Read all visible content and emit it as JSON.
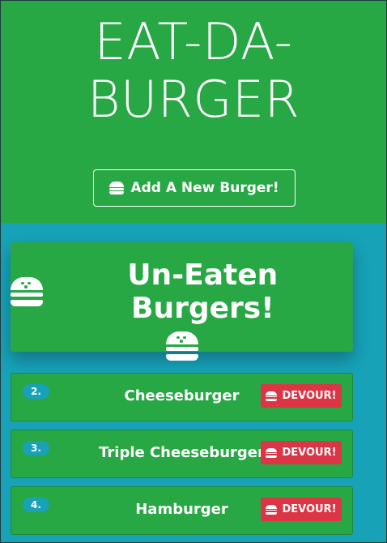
{
  "header": {
    "title_line1": "EAT-DA-",
    "title_line2": "BURGER",
    "add_button_label": "Add A New Burger!"
  },
  "section": {
    "title": "Un-Eaten Burgers!"
  },
  "burgers": [
    {
      "number": "2.",
      "name": "Cheeseburger",
      "action": "DEVOUR!"
    },
    {
      "number": "3.",
      "name": "Triple Cheeseburger",
      "action": "DEVOUR!"
    },
    {
      "number": "4.",
      "name": "Hamburger",
      "action": "DEVOUR!"
    }
  ],
  "icons": {
    "burger": "hamburger-icon"
  },
  "colors": {
    "header_bg": "#28a745",
    "page_bg": "#17a2b8",
    "devour_bg": "#dc3545"
  }
}
